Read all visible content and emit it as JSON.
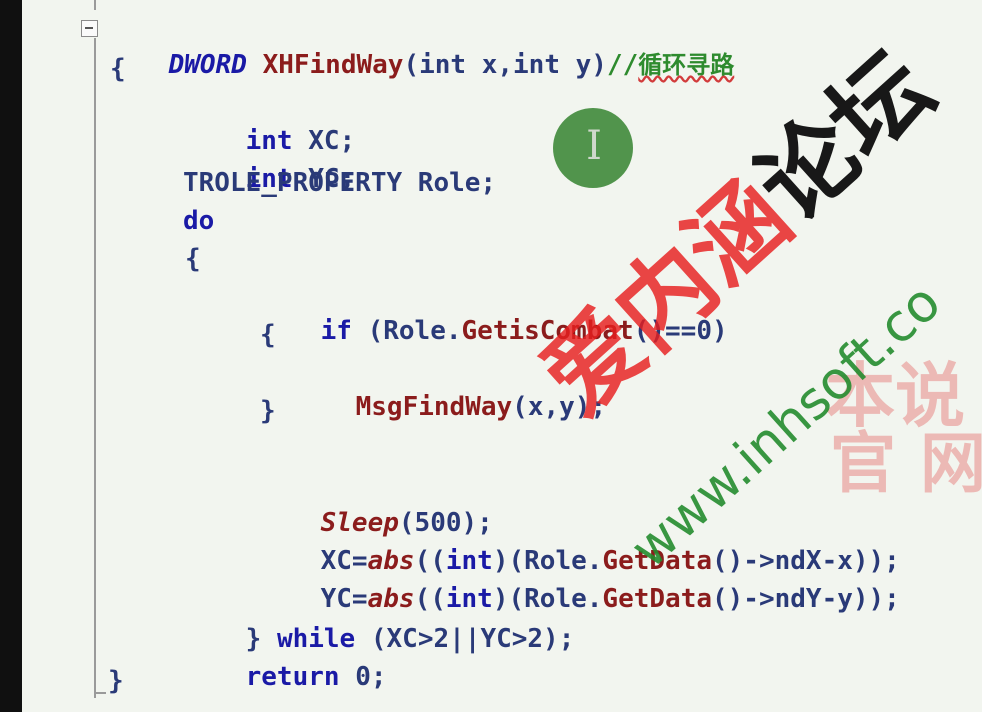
{
  "editor": {
    "code": {
      "signature": {
        "return_type": "DWORD",
        "func_name": "XHFindWay",
        "params": "(int x,int y)",
        "comment_marker": "//",
        "comment_text": "循环寻路"
      },
      "brace_open": "{",
      "decl_xc": {
        "type": "int",
        "name": "XC;"
      },
      "decl_yc": {
        "type": "int",
        "name": "YC;"
      },
      "decl_role": "TROLE_PROPERTY Role;",
      "do_keyword": "do",
      "do_brace_open": "{",
      "if_stmt": {
        "keyword": "if",
        "pre": " (Role.",
        "method": "GetisCombat",
        "post": "()==0)"
      },
      "if_brace_open": "{",
      "call_find": {
        "func": "MsgFindWay",
        "args": "(x,y);"
      },
      "if_brace_close": "}",
      "sleep": {
        "func": "Sleep",
        "args": "(500);"
      },
      "xc_assign": {
        "lhs": "XC=",
        "func": "abs",
        "pre": "((",
        "cast": "int",
        "mid": ")(Role.",
        "method": "GetData",
        "post": "()->ndX-x));"
      },
      "yc_assign": {
        "lhs": "YC=",
        "func": "abs",
        "pre": "((",
        "cast": "int",
        "mid": ")(Role.",
        "method": "GetData",
        "post": "()->ndY-y));"
      },
      "while_stmt": {
        "brace": "} ",
        "keyword": "while",
        "cond": " (XC>2||YC>2);"
      },
      "return_stmt": {
        "keyword": "return",
        "value": " 0;"
      },
      "brace_close": "}"
    },
    "cursor": {
      "icon": "i-beam-cursor-icon",
      "glyph": "I",
      "highlight_color": "#3f8a3a"
    }
  },
  "watermark": {
    "forum_name_a": "爱内",
    "forum_name_b": "涵",
    "forum_name_c": "论坛",
    "url": "www.inhsoft.co",
    "site_line1": "本说",
    "site_line2": "官网"
  },
  "colors": {
    "background": "#f2f5ef",
    "keyword": "#1a1aa6",
    "function": "#8b1c1c",
    "comment": "#2e8b2e",
    "watermark_red": "#e61e1e",
    "watermark_green": "#238c2d"
  }
}
